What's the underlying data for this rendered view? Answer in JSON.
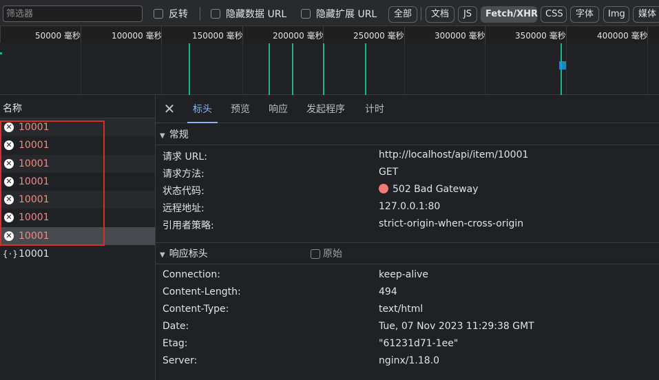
{
  "filter": {
    "placeholder": "筛选器",
    "invert_label": "反转",
    "hide_data_url_label": "隐藏数据 URL",
    "hide_ext_url_label": "隐藏扩展 URL",
    "types": [
      "全部",
      "文档",
      "JS",
      "Fetch/XHR",
      "CSS",
      "字体",
      "Img",
      "媒体"
    ],
    "selected_type": "Fetch/XHR"
  },
  "timeline": {
    "ticks": [
      "50000 毫秒",
      "100000 毫秒",
      "150000 毫秒",
      "200000 毫秒",
      "250000 毫秒",
      "300000 毫秒",
      "350000 毫秒",
      "400000 毫秒"
    ]
  },
  "list": {
    "header": "名称",
    "rows": [
      {
        "name": "10001",
        "status": "error"
      },
      {
        "name": "10001",
        "status": "error"
      },
      {
        "name": "10001",
        "status": "error"
      },
      {
        "name": "10001",
        "status": "error"
      },
      {
        "name": "10001",
        "status": "error"
      },
      {
        "name": "10001",
        "status": "error"
      },
      {
        "name": "10001",
        "status": "error",
        "selected": true
      },
      {
        "name": "10001",
        "status": "ok"
      }
    ]
  },
  "detail": {
    "tabs": [
      "标头",
      "预览",
      "响应",
      "发起程序",
      "计时"
    ],
    "active_tab": "标头",
    "general": {
      "title": "常规",
      "items": [
        {
          "key": "请求 URL:",
          "value": "http://localhost/api/item/10001"
        },
        {
          "key": "请求方法:",
          "value": "GET"
        },
        {
          "key": "状态代码:",
          "value": "502 Bad Gateway"
        },
        {
          "key": "远程地址:",
          "value": "127.0.0.1:80"
        },
        {
          "key": "引用者策略:",
          "value": "strict-origin-when-cross-origin"
        }
      ]
    },
    "response_headers": {
      "title": "响应标头",
      "raw_label": "原始",
      "items": [
        {
          "key": "Connection:",
          "value": "keep-alive"
        },
        {
          "key": "Content-Length:",
          "value": "494"
        },
        {
          "key": "Content-Type:",
          "value": "text/html"
        },
        {
          "key": "Date:",
          "value": "Tue, 07 Nov 2023 11:29:38 GMT"
        },
        {
          "key": "Etag:",
          "value": "\"61231d71-1ee\""
        },
        {
          "key": "Server:",
          "value": "nginx/1.18.0"
        }
      ]
    }
  },
  "colors": {
    "error_text": "#f28b82",
    "status_dot": "#ee7b75",
    "accent": "#8ab4f8",
    "timeline_bar": "#1db58c",
    "highlight_box": "#d93025"
  }
}
